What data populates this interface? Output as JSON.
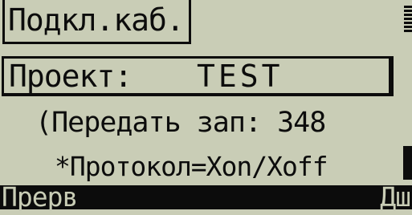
{
  "screen": {
    "title": "Подкл.каб.",
    "project_label": "Проект:",
    "project_value": "TEST",
    "transfer_text": "(Передать зап: 348",
    "protocol_text": "*Протокол=Xon/Xoff"
  },
  "softkeys": {
    "left": "Прерв",
    "right": "Дш"
  },
  "colors": {
    "lcd_background": "#c9cdb6",
    "lcd_foreground": "#0c0c0c"
  }
}
